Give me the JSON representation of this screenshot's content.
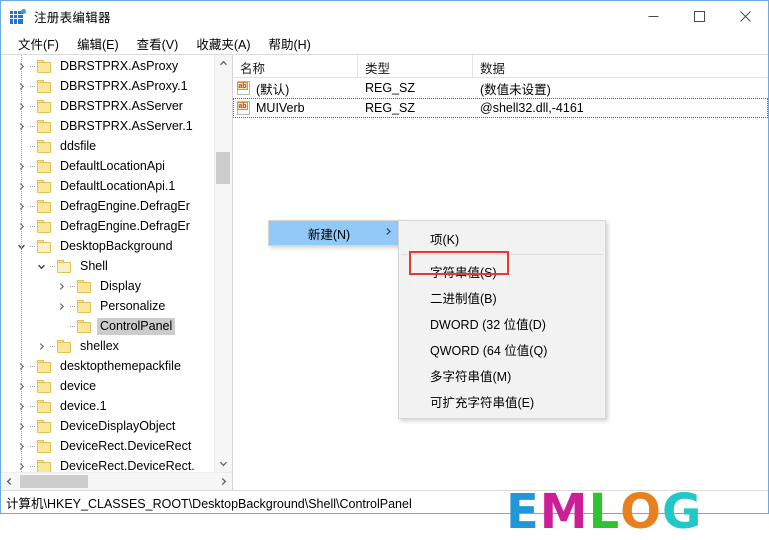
{
  "window": {
    "title": "注册表编辑器",
    "app_icon": "registry-grid-icon",
    "controls": {
      "minimize": "minimize-icon",
      "maximize": "maximize-icon",
      "close": "close-icon"
    }
  },
  "menubar": {
    "items": [
      {
        "label": "文件(F)"
      },
      {
        "label": "编辑(E)"
      },
      {
        "label": "查看(V)"
      },
      {
        "label": "收藏夹(A)"
      },
      {
        "label": "帮助(H)"
      }
    ]
  },
  "tree": {
    "items": [
      {
        "label": "DBRSTPRX.AsProxy",
        "indent": 1,
        "twisty": "collapsed",
        "selected": false
      },
      {
        "label": "DBRSTPRX.AsProxy.1",
        "indent": 1,
        "twisty": "collapsed",
        "selected": false
      },
      {
        "label": "DBRSTPRX.AsServer",
        "indent": 1,
        "twisty": "collapsed",
        "selected": false
      },
      {
        "label": "DBRSTPRX.AsServer.1",
        "indent": 1,
        "twisty": "collapsed",
        "selected": false
      },
      {
        "label": "ddsfile",
        "indent": 1,
        "twisty": "none",
        "selected": false
      },
      {
        "label": "DefaultLocationApi",
        "indent": 1,
        "twisty": "collapsed",
        "selected": false
      },
      {
        "label": "DefaultLocationApi.1",
        "indent": 1,
        "twisty": "collapsed",
        "selected": false
      },
      {
        "label": "DefragEngine.DefragEr",
        "indent": 1,
        "twisty": "collapsed",
        "selected": false
      },
      {
        "label": "DefragEngine.DefragEr",
        "indent": 1,
        "twisty": "collapsed",
        "selected": false
      },
      {
        "label": "DesktopBackground",
        "indent": 1,
        "twisty": "expanded",
        "selected": false
      },
      {
        "label": "Shell",
        "indent": 2,
        "twisty": "expanded",
        "selected": false
      },
      {
        "label": "Display",
        "indent": 3,
        "twisty": "collapsed",
        "selected": false
      },
      {
        "label": "Personalize",
        "indent": 3,
        "twisty": "collapsed",
        "selected": false
      },
      {
        "label": "ControlPanel",
        "indent": 3,
        "twisty": "none",
        "selected": true
      },
      {
        "label": "shellex",
        "indent": 2,
        "twisty": "collapsed",
        "selected": false
      },
      {
        "label": "desktopthemepackfile",
        "indent": 1,
        "twisty": "collapsed",
        "selected": false
      },
      {
        "label": "device",
        "indent": 1,
        "twisty": "collapsed",
        "selected": false
      },
      {
        "label": "device.1",
        "indent": 1,
        "twisty": "collapsed",
        "selected": false
      },
      {
        "label": "DeviceDisplayObject",
        "indent": 1,
        "twisty": "collapsed",
        "selected": false
      },
      {
        "label": "DeviceRect.DeviceRect",
        "indent": 1,
        "twisty": "collapsed",
        "selected": false
      },
      {
        "label": "DeviceRect.DeviceRect.",
        "indent": 1,
        "twisty": "collapsed",
        "selected": false
      }
    ],
    "vscroll": {
      "up_icon": "chevron-up-icon",
      "down_icon": "chevron-down-icon"
    },
    "hscroll": {
      "left_icon": "chevron-left-icon",
      "right_icon": "chevron-right-icon"
    }
  },
  "list": {
    "columns": [
      "名称",
      "类型",
      "数据"
    ],
    "rows": [
      {
        "name": "(默认)",
        "type": "REG_SZ",
        "data": "(数值未设置)",
        "icon": "ab-string-icon",
        "focused": false
      },
      {
        "name": "MUIVerb",
        "type": "REG_SZ",
        "data": "@shell32.dll,-4161",
        "icon": "ab-string-icon",
        "focused": true
      }
    ]
  },
  "context_menu": {
    "parent": {
      "label": "新建(N)",
      "arrow": "❯",
      "highlighted": true
    },
    "submenu": {
      "items": [
        {
          "label": "项(K)",
          "separator_after": true
        },
        {
          "label": "字符串值(S)",
          "highlighted_box": true
        },
        {
          "label": "二进制值(B)"
        },
        {
          "label": "DWORD (32 位值(D)"
        },
        {
          "label": "QWORD (64 位值(Q)"
        },
        {
          "label": "多字符串值(M)"
        },
        {
          "label": "可扩充字符串值(E)"
        }
      ]
    },
    "annotation_color": "#e23b34"
  },
  "watermark": {
    "letters": [
      {
        "char": "E",
        "color": "#2196d9"
      },
      {
        "char": "M",
        "color": "#cc1f96"
      },
      {
        "char": "L",
        "color": "#2fc42f"
      },
      {
        "char": "O",
        "color": "#e8801f"
      },
      {
        "char": "G",
        "color": "#22c8c8"
      }
    ]
  },
  "statusbar": {
    "path": "计算机\\HKEY_CLASSES_ROOT\\DesktopBackground\\Shell\\ControlPanel"
  }
}
